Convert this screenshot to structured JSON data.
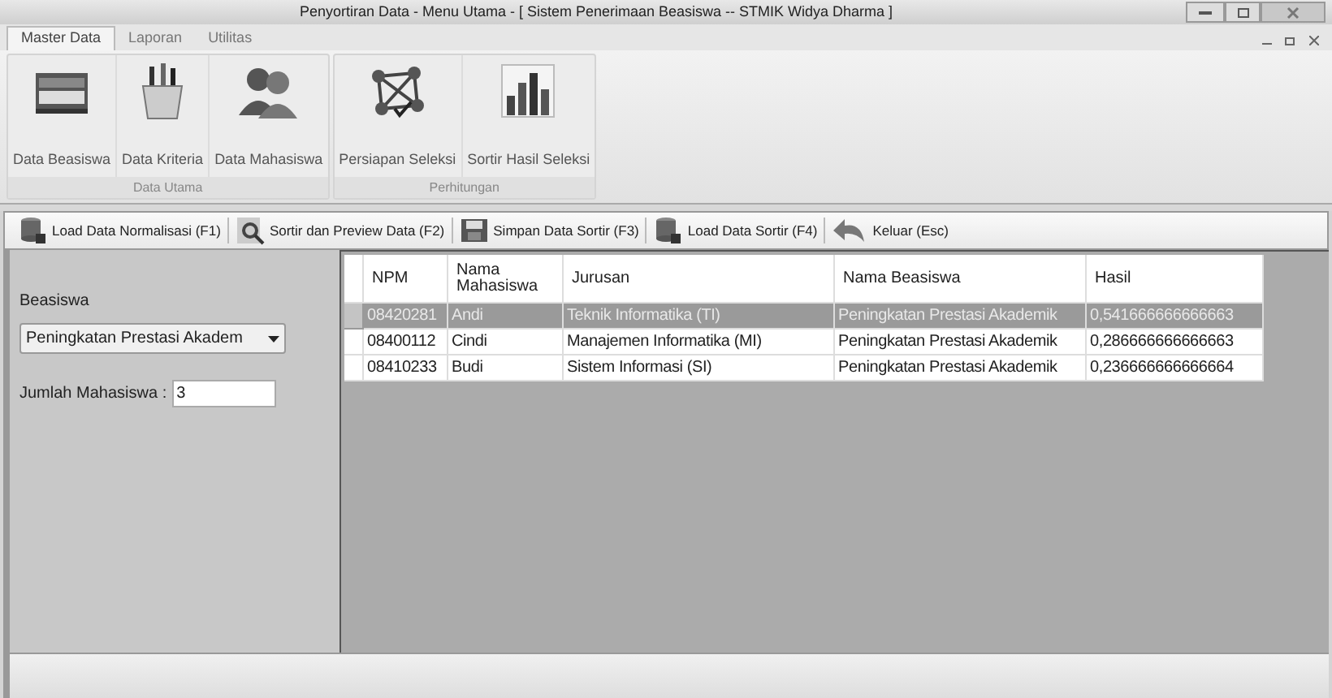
{
  "window": {
    "title": "Penyortiran Data - Menu Utama - [ Sistem Penerimaan Beasiswa -- STMIK Widya Dharma ]"
  },
  "ribbon_tabs": [
    {
      "label": "Master Data",
      "selected": true
    },
    {
      "label": "Laporan",
      "selected": false
    },
    {
      "label": "Utilitas",
      "selected": false
    }
  ],
  "ribbon_groups": [
    {
      "label": "Data Utama",
      "buttons": [
        {
          "label": "Data Beasiswa",
          "kind": "card"
        },
        {
          "label": "Data Kriteria",
          "kind": "pens"
        },
        {
          "label": "Data Mahasiswa",
          "kind": "people"
        }
      ]
    },
    {
      "label": "Perhitungan",
      "buttons": [
        {
          "label": "Persiapan Seleksi",
          "kind": "network"
        },
        {
          "label": "Sortir Hasil Seleksi",
          "kind": "chart"
        }
      ]
    }
  ],
  "toolbar": [
    {
      "label": "Load Data Normalisasi (F1)",
      "kind": "db"
    },
    {
      "label": "Sortir dan Preview Data (F2)",
      "kind": "search"
    },
    {
      "label": "Simpan Data Sortir (F3)",
      "kind": "save"
    },
    {
      "label": "Load Data Sortir (F4)",
      "kind": "db"
    },
    {
      "label": "Keluar (Esc)",
      "kind": "undo"
    }
  ],
  "form": {
    "beasiswa_label": "Beasiswa",
    "beasiswa_value": "Peningkatan Prestasi Akadem",
    "jumlah_label": "Jumlah Mahasiswa :",
    "jumlah_value": "3"
  },
  "table": {
    "columns": [
      "NPM",
      "Nama Mahasiswa",
      "Jurusan",
      "Nama Beasiswa",
      "Hasil"
    ],
    "rows": [
      {
        "selected": true,
        "cells": [
          "08420281",
          "Andi",
          "Teknik Informatika (TI)",
          "Peningkatan Prestasi Akademik",
          "0,541666666666663"
        ]
      },
      {
        "selected": false,
        "cells": [
          "08400112",
          "Cindi",
          "Manajemen Informatika (MI)",
          "Peningkatan Prestasi Akademik",
          "0,286666666666663"
        ]
      },
      {
        "selected": false,
        "cells": [
          "08410233",
          "Budi",
          "Sistem Informasi (SI)",
          "Peningkatan Prestasi Akademik",
          "0,236666666666664"
        ]
      }
    ]
  }
}
